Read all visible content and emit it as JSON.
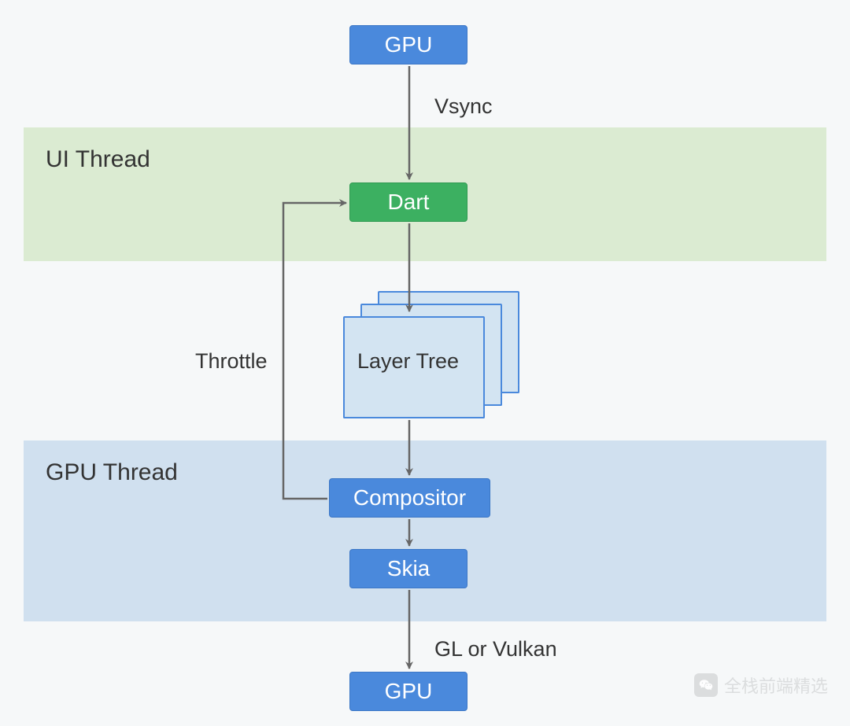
{
  "bands": {
    "ui": "UI Thread",
    "gpu": "GPU Thread"
  },
  "nodes": {
    "gpu_top": "GPU",
    "dart": "Dart",
    "layer_tree": "Layer Tree",
    "compositor": "Compositor",
    "skia": "Skia",
    "gpu_bottom": "GPU"
  },
  "edges": {
    "vsync": "Vsync",
    "throttle": "Throttle",
    "gl_or_vulkan": "GL or Vulkan"
  },
  "watermark": "全栈前端精选",
  "colors": {
    "blue": "#4a89dc",
    "green": "#3cb061",
    "ui_band": "#dbebd2",
    "gpu_band": "#d0e0ef",
    "doc_fill": "#d3e4f2",
    "arrow": "#666666"
  }
}
